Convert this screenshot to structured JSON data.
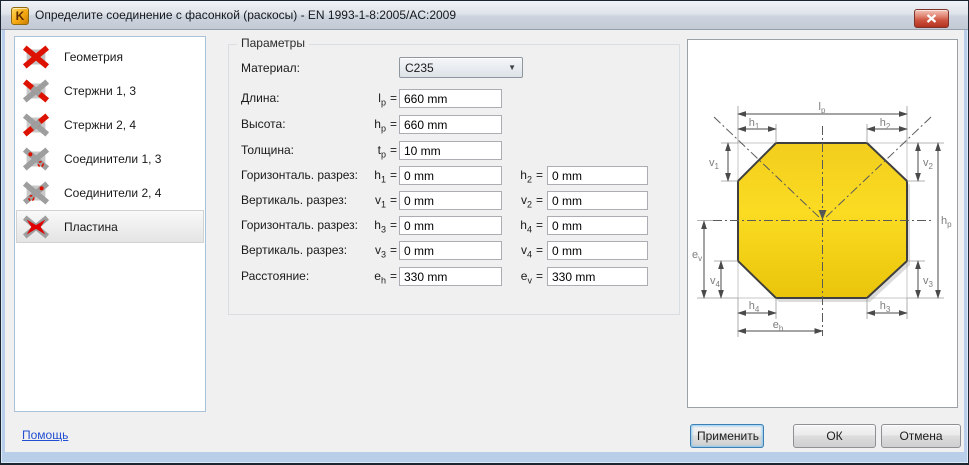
{
  "window": {
    "title": "Определите соединение с фасонкой (раскосы)  - EN 1993-1-8:2005/AC:2009",
    "icon_letter": "K"
  },
  "sidebar": {
    "items": [
      {
        "label": "Геометрия",
        "icon": "braces-cross-red",
        "selected": false
      },
      {
        "label": "Стержни 1, 3",
        "icon": "braces-1-3-red",
        "selected": false
      },
      {
        "label": "Стержни 2, 4",
        "icon": "braces-2-4-red",
        "selected": false
      },
      {
        "label": "Соединители 1, 3",
        "icon": "connectors-1-3",
        "selected": false
      },
      {
        "label": "Соединители 2, 4",
        "icon": "connectors-2-4",
        "selected": false
      },
      {
        "label": "Пластина",
        "icon": "plate-red-center",
        "selected": true
      }
    ]
  },
  "params": {
    "title": "Параметры",
    "eq": "=",
    "combo_arrow": "▼",
    "material": {
      "label": "Материал:",
      "value": "C235"
    },
    "rows": [
      {
        "label": "Длина:",
        "fields": [
          {
            "sym": "l",
            "sub": "p",
            "value": "660 mm"
          }
        ]
      },
      {
        "label": "Высота:",
        "fields": [
          {
            "sym": "h",
            "sub": "p",
            "value": "660 mm"
          }
        ]
      },
      {
        "label": "Толщина:",
        "fields": [
          {
            "sym": "t",
            "sub": "p",
            "value": "10 mm"
          }
        ]
      },
      {
        "label": "Горизонталь. разрез:",
        "fields": [
          {
            "sym": "h",
            "sub": "1",
            "value": "0 mm"
          },
          {
            "sym": "h",
            "sub": "2",
            "value": "0 mm"
          }
        ]
      },
      {
        "label": "Вертикаль. разрез:",
        "fields": [
          {
            "sym": "v",
            "sub": "1",
            "value": "0 mm"
          },
          {
            "sym": "v",
            "sub": "2",
            "value": "0 mm"
          }
        ]
      },
      {
        "label": "Горизонталь. разрез:",
        "fields": [
          {
            "sym": "h",
            "sub": "3",
            "value": "0 mm"
          },
          {
            "sym": "h",
            "sub": "4",
            "value": "0 mm"
          }
        ]
      },
      {
        "label": "Вертикаль. разрез:",
        "fields": [
          {
            "sym": "v",
            "sub": "3",
            "value": "0 mm"
          },
          {
            "sym": "v",
            "sub": "4",
            "value": "0 mm"
          }
        ]
      },
      {
        "label": "Расстояние:",
        "fields": [
          {
            "sym": "e",
            "sub": "h",
            "value": "330 mm"
          },
          {
            "sym": "e",
            "sub": "v",
            "value": "330 mm"
          }
        ]
      }
    ]
  },
  "diagram": {
    "labels": {
      "lp": {
        "m": "l",
        "s": "p"
      },
      "h1": {
        "m": "h",
        "s": "1"
      },
      "h2": {
        "m": "h",
        "s": "2"
      },
      "v1": {
        "m": "v",
        "s": "1"
      },
      "v2": {
        "m": "v",
        "s": "2"
      },
      "hp": {
        "m": "h",
        "s": "p"
      },
      "ev": {
        "m": "e",
        "s": "v"
      },
      "v4": {
        "m": "v",
        "s": "4"
      },
      "v3": {
        "m": "v",
        "s": "3"
      },
      "h4": {
        "m": "h",
        "s": "4"
      },
      "h3": {
        "m": "h",
        "s": "3"
      },
      "eh": {
        "m": "e",
        "s": "h"
      }
    }
  },
  "footer": {
    "help": "Помощь",
    "apply": "Применить",
    "ok": "ОК",
    "cancel": "Отмена"
  },
  "colors": {
    "plate_yellow": "#f5d41e",
    "accent_red": "#dd1100",
    "icon_gray": "#9e9e9e",
    "window_border_blue": "#b9cfe9",
    "titlebar_silver": "#d8dde4",
    "client_gray": "#f0f0f0",
    "link_blue": "#2350d2",
    "close_button_red": "#c34531"
  }
}
